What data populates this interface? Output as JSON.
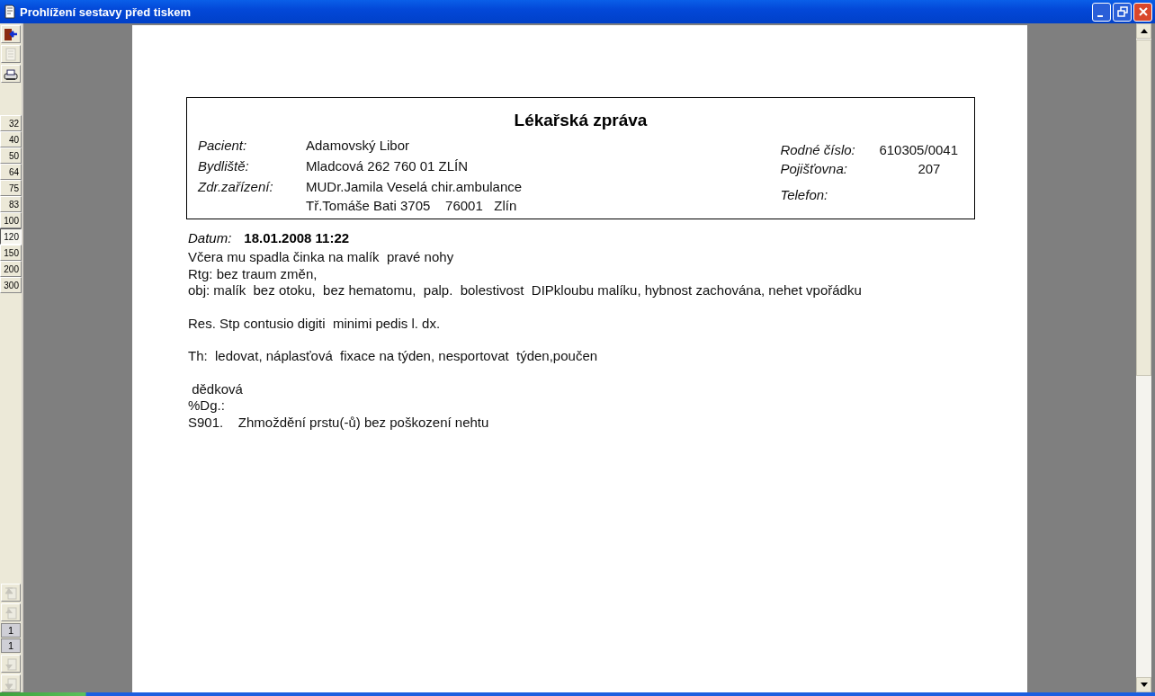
{
  "window": {
    "title": "Prohlížení sestavy před tiskem"
  },
  "toolbar": {
    "tools": [
      {
        "kind": "exit",
        "disabled": false
      },
      {
        "kind": "setup",
        "disabled": true
      },
      {
        "kind": "print",
        "disabled": false
      }
    ],
    "zoom_levels": [
      {
        "label": "32",
        "selected": false
      },
      {
        "label": "40",
        "selected": false
      },
      {
        "label": "50",
        "selected": false
      },
      {
        "label": "64",
        "selected": false
      },
      {
        "label": "75",
        "selected": false
      },
      {
        "label": "83",
        "selected": false
      },
      {
        "label": "100",
        "selected": false
      },
      {
        "label": "120",
        "selected": true
      },
      {
        "label": "150",
        "selected": false
      },
      {
        "label": "200",
        "selected": false
      },
      {
        "label": "300",
        "selected": false
      }
    ],
    "nav_before": [
      {
        "kind": "first",
        "disabled": true
      },
      {
        "kind": "prev",
        "disabled": true
      }
    ],
    "page_fields": [
      "1",
      "1"
    ],
    "nav_after": [
      {
        "kind": "next",
        "disabled": true
      },
      {
        "kind": "last",
        "disabled": true
      }
    ]
  },
  "report": {
    "title": "Lékařská zpráva",
    "left_fields": [
      {
        "label": "Pacient:",
        "lines": [
          "Adamovský Libor"
        ]
      },
      {
        "label": "Bydliště:",
        "lines": [
          "Mladcová 262 760 01 ZLÍN"
        ]
      },
      {
        "label": "Zdr.zařízení:",
        "lines": [
          "MUDr.Jamila Veselá chir.ambulance",
          "Tř.Tomáše Bati 3705    76001   Zlín"
        ]
      }
    ],
    "right_fields": [
      {
        "label": "Rodné číslo:",
        "value": "610305/0041"
      },
      {
        "label": "Pojišťovna:",
        "value": "207"
      },
      {
        "label": "Telefon:"
      }
    ],
    "date": {
      "label": "Datum:",
      "value": "18.01.2008 11:22"
    },
    "paragraphs": [
      [
        "Včera mu spadla činka na malík  pravé nohy",
        "Rtg: bez traum změn,",
        "obj: malík  bez otoku,  bez hematomu,  palp.  bolestivost  DIPkloubu malíku, hybnost zachována, nehet vpořádku"
      ],
      [
        "Res. Stp contusio digiti  minimi pedis l. dx."
      ],
      [
        "Th:  ledovat, náplasťová  fixace na týden, nesportovat  týden,poučen"
      ],
      [
        " dědková",
        "%Dg.:",
        "S901.    Zhmoždění prstu(-ů) bez poškození nehtu"
      ]
    ]
  }
}
